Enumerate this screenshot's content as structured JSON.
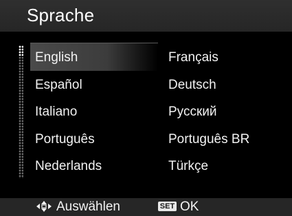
{
  "header": {
    "title": "Sprache"
  },
  "languages": {
    "left": [
      "English",
      "Español",
      "Italiano",
      "Português",
      "Nederlands"
    ],
    "right": [
      "Français",
      "Deutsch",
      "Русский",
      "Português BR",
      "Türkçe"
    ],
    "selected": "English"
  },
  "footer": {
    "select_icon": "four-way-arrows-icon",
    "select_label": "Auswählen",
    "set_icon_label": "SET",
    "ok_label": "OK"
  },
  "colors": {
    "background": "#000000",
    "bar": "#262626",
    "text": "#f2f2f2",
    "highlight": "#4a4a4a"
  }
}
